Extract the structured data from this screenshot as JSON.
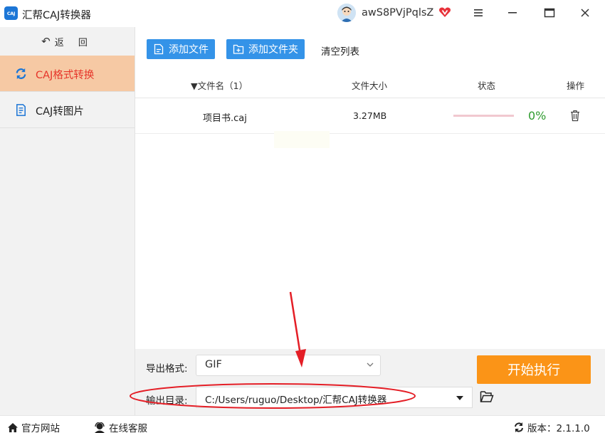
{
  "window": {
    "app_logo_text": "CAJ",
    "title": "汇帮CAJ转换器",
    "username": "awS8PVjPqlsZ",
    "vip_icon": "vip-heart-icon"
  },
  "sidebar": {
    "back_label": "返 回",
    "items": [
      {
        "label": "CAJ格式转换",
        "icon": "refresh-icon",
        "active": true
      },
      {
        "label": "CAJ转图片",
        "icon": "document-icon",
        "active": false
      }
    ]
  },
  "toolbar": {
    "add_file": "添加文件",
    "add_folder": "添加文件夹",
    "clear_list": "清空列表"
  },
  "table": {
    "columns": {
      "name": "文件名（1）",
      "size": "文件大小",
      "status": "状态",
      "actions": "操作"
    },
    "rows": [
      {
        "name": "项目书.caj",
        "size": "3.27MB",
        "progress": 0,
        "percent": "0%"
      }
    ]
  },
  "settings": {
    "format_label": "导出格式:",
    "format_value": "GIF",
    "output_label": "输出目录:",
    "output_value": "C:/Users/ruguo/Desktop/汇帮CAJ转换器",
    "start_button": "开始执行"
  },
  "statusbar": {
    "site": "官方网站",
    "support": "在线客服",
    "version": "版本：2.1.1.0"
  },
  "colors": {
    "accent_blue": "#3493e8",
    "start_orange": "#fb9417",
    "active_nav_bg": "#f6c9a4",
    "active_nav_text": "#e6352a",
    "annotation_red": "#e41e26"
  }
}
